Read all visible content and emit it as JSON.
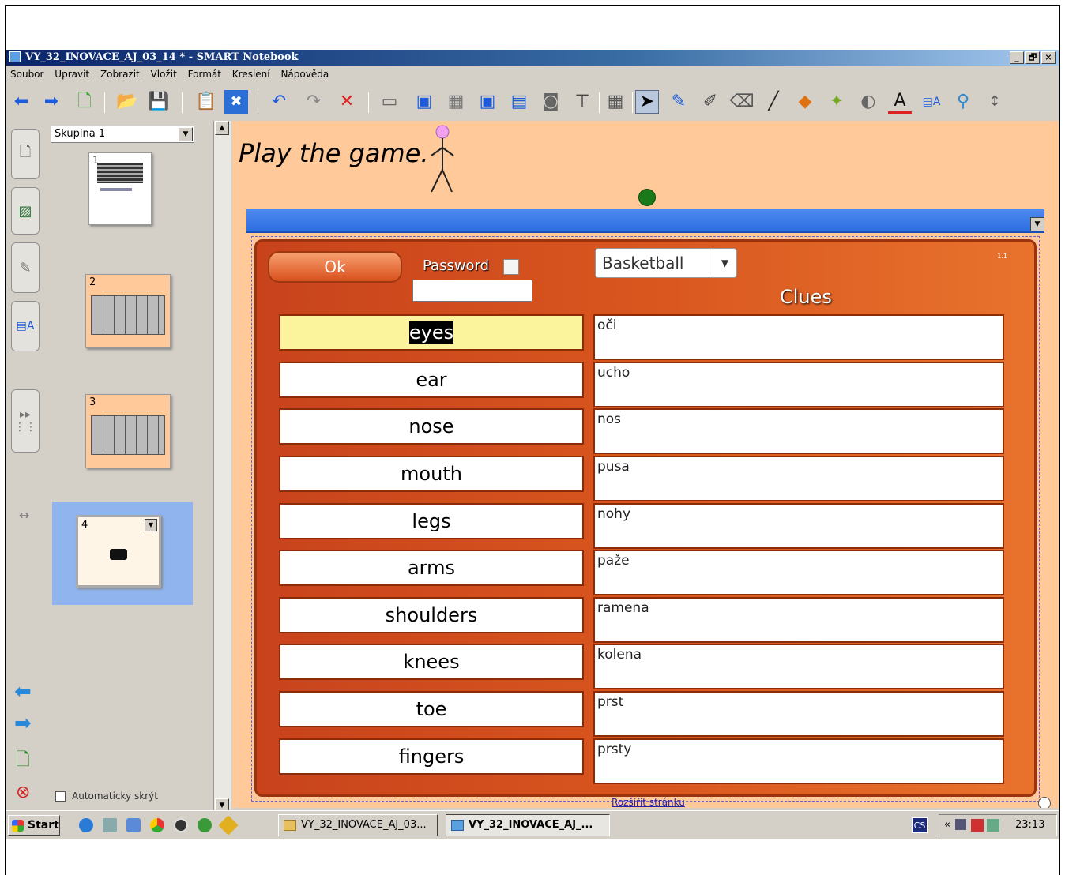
{
  "window": {
    "title": "VY_32_INOVACE_AJ_03_14 * - SMART Notebook",
    "min": "_",
    "max": "🗗",
    "close": "×"
  },
  "menu": [
    "Soubor",
    "Upravit",
    "Zobrazit",
    "Vložit",
    "Formát",
    "Kreslení",
    "Nápověda"
  ],
  "sorter": {
    "group": "Skupina 1",
    "pages": [
      "1",
      "2",
      "3",
      "4"
    ],
    "autohide_label": "Automaticky skrýt"
  },
  "page": {
    "heading": "Play the game.",
    "game": {
      "ok_label": "Ok",
      "password_label": "Password",
      "password_value": "",
      "theme": "Basketball",
      "clues_title": "Clues",
      "mini_label": "1.1",
      "words": [
        "eyes",
        "ear",
        "nose",
        "mouth",
        "legs",
        "arms",
        "shoulders",
        "knees",
        "toe",
        "fingers"
      ],
      "clues": [
        "oči",
        "ucho",
        "nos",
        "pusa",
        "nohy",
        "paže",
        "ramena",
        "kolena",
        "prst",
        "prsty"
      ]
    },
    "expand_link": "Rozšířit stránku"
  },
  "taskbar": {
    "start": "Start",
    "tasks": [
      "VY_32_INOVACE_AJ_03...",
      "VY_32_INOVACE_AJ_..."
    ],
    "lang": "CS",
    "tray_chevron": "«",
    "clock": "23:13"
  }
}
